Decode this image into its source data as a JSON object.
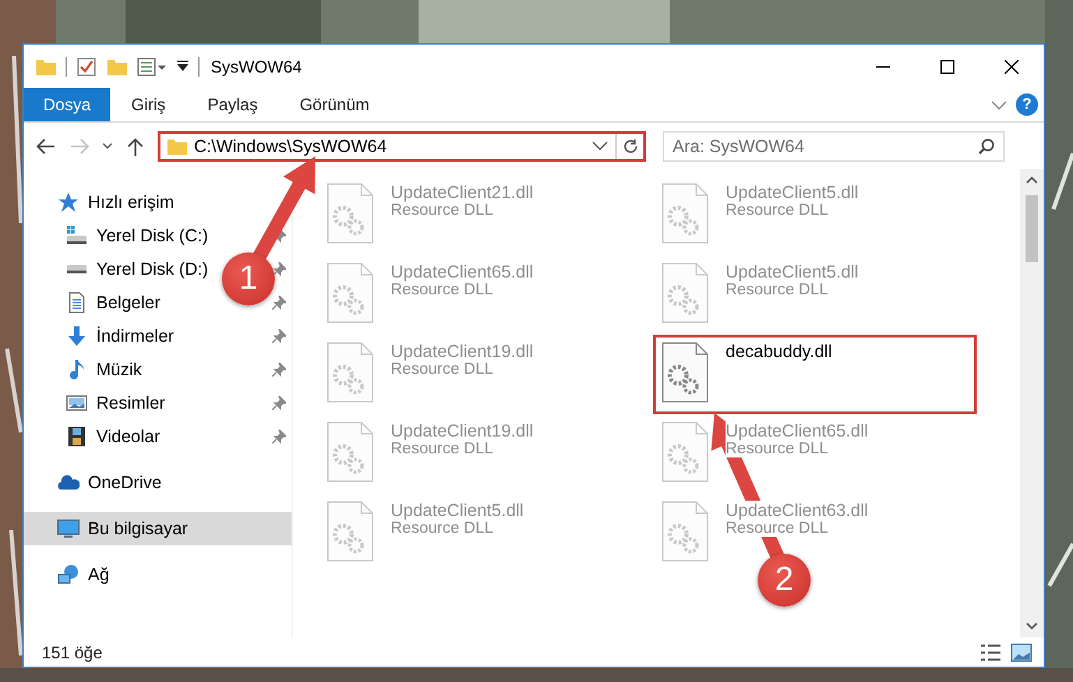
{
  "window": {
    "title": "SysWOW64"
  },
  "ribbon": {
    "tabs": [
      {
        "label": "Dosya",
        "selected": true
      },
      {
        "label": "Giriş",
        "selected": false
      },
      {
        "label": "Paylaş",
        "selected": false
      },
      {
        "label": "Görünüm",
        "selected": false
      }
    ],
    "help": "?"
  },
  "address_bar": {
    "value": "C:\\Windows\\SysWOW64",
    "highlighted": true
  },
  "search": {
    "placeholder": "Ara: SysWOW64"
  },
  "sidebar": {
    "items": [
      {
        "label": "Hızlı erişim",
        "kind": "star",
        "selected": false,
        "children": [
          {
            "label": "Yerel Disk (C:)",
            "kind": "drive-c",
            "selected": false,
            "pinned": true
          },
          {
            "label": "Yerel Disk (D:)",
            "kind": "drive",
            "selected": false,
            "pinned": true
          },
          {
            "label": "Belgeler",
            "kind": "document",
            "selected": false,
            "pinned": true
          },
          {
            "label": "İndirmeler",
            "kind": "download",
            "selected": false,
            "pinned": true
          },
          {
            "label": "Müzik",
            "kind": "music",
            "selected": false,
            "pinned": true
          },
          {
            "label": "Resimler",
            "kind": "pictures",
            "selected": false,
            "pinned": true
          },
          {
            "label": "Videolar",
            "kind": "video",
            "selected": false,
            "pinned": true
          }
        ]
      },
      {
        "label": "OneDrive",
        "kind": "cloud",
        "selected": false
      },
      {
        "label": "Bu bilgisayar",
        "kind": "computer",
        "selected": true
      },
      {
        "label": "Ağ",
        "kind": "network",
        "selected": false
      }
    ]
  },
  "files": [
    {
      "name": "UpdateClient21.dll",
      "type": "Resource DLL",
      "blurred": true,
      "highlighted": false
    },
    {
      "name": "UpdateClient5.dll",
      "type": "Resource DLL",
      "blurred": true,
      "highlighted": false
    },
    {
      "name": "UpdateClient65.dll",
      "type": "Resource DLL",
      "blurred": true,
      "highlighted": false
    },
    {
      "name": "UpdateClient5.dll",
      "type": "Resource DLL",
      "blurred": true,
      "highlighted": false
    },
    {
      "name": "UpdateClient19.dll",
      "type": "Resource DLL",
      "blurred": true,
      "highlighted": false
    },
    {
      "name": "decabuddy.dll",
      "blurred": false,
      "highlighted": true
    },
    {
      "name": "UpdateClient19.dll",
      "type": "Resource DLL",
      "blurred": true,
      "highlighted": false
    },
    {
      "name": "UpdateClient65.dll",
      "type": "Resource DLL",
      "blurred": true,
      "highlighted": false
    },
    {
      "name": "UpdateClient5.dll",
      "type": "Resource DLL",
      "blurred": true,
      "highlighted": false
    },
    {
      "name": "UpdateClient63.dll",
      "type": "Resource DLL",
      "blurred": true,
      "highlighted": false
    }
  ],
  "status_bar": {
    "count": "151 öğe"
  },
  "annotations": [
    {
      "label": "1"
    },
    {
      "label": "2"
    }
  ]
}
